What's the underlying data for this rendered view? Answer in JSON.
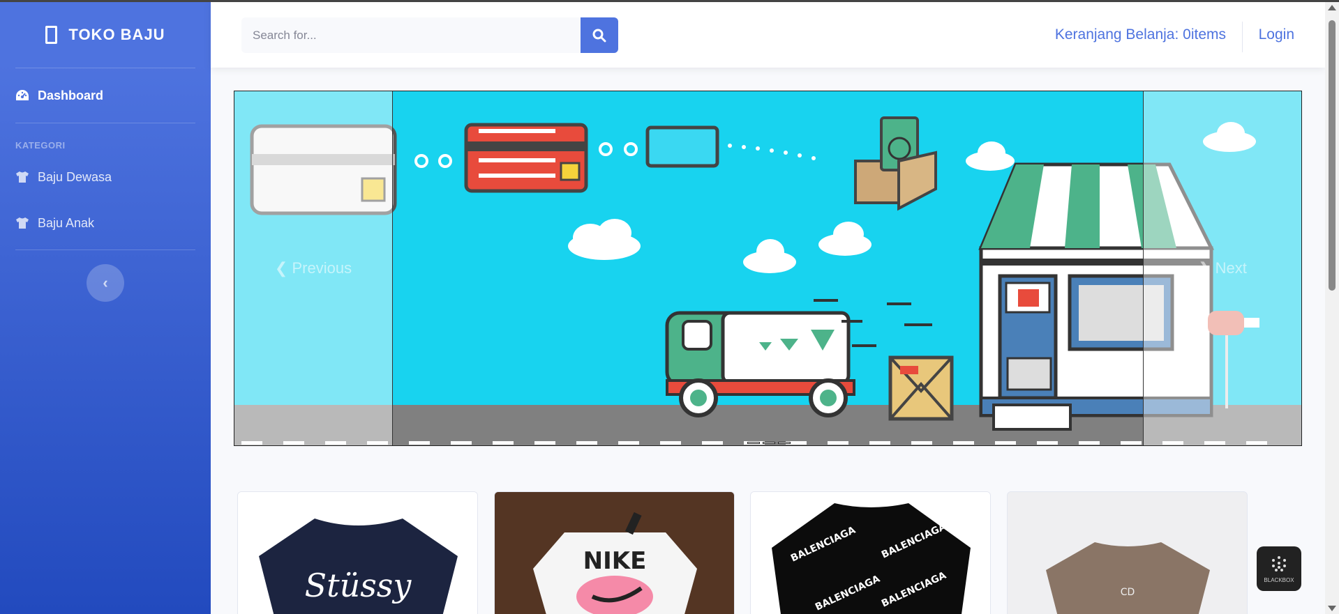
{
  "brand": {
    "name": "TOKO BAJU"
  },
  "sidebar": {
    "dashboard_label": "Dashboard",
    "category_heading": "KATEGORI",
    "items": [
      {
        "label": "Baju Dewasa",
        "icon": "tshirt-icon"
      },
      {
        "label": "Baju Anak",
        "icon": "tshirt-icon"
      }
    ]
  },
  "topbar": {
    "search_placeholder": "Search for...",
    "cart_label": "Keranjang Belanja: 0items",
    "login_label": "Login"
  },
  "carousel": {
    "prev_label": "Previous",
    "next_label": "Next",
    "indicator_count": 3
  },
  "products": [
    {
      "image": "stussy-navy-tshirt",
      "text": "Stüssy"
    },
    {
      "image": "nike-white-tshirt",
      "text": "NIKE"
    },
    {
      "image": "balenciaga-black-tshirt",
      "text": "BALENCIAGA PARIS"
    },
    {
      "image": "dior-brown-tshirt",
      "text": "CD"
    }
  ],
  "badge": {
    "label": "BLACKBOX"
  },
  "colors": {
    "primary": "#4e73df",
    "sky": "#18d3ef",
    "dark": "#222222"
  }
}
